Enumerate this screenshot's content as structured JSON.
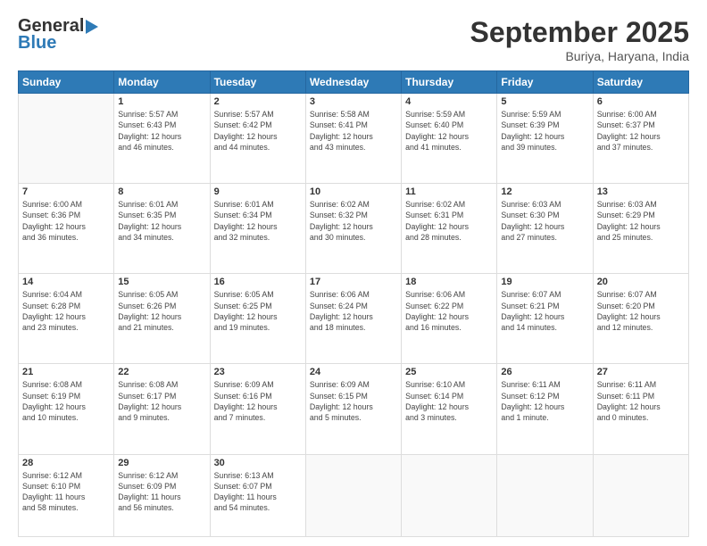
{
  "header": {
    "logo_line1": "General",
    "logo_line2": "Blue",
    "month_title": "September 2025",
    "location": "Buriya, Haryana, India"
  },
  "weekdays": [
    "Sunday",
    "Monday",
    "Tuesday",
    "Wednesday",
    "Thursday",
    "Friday",
    "Saturday"
  ],
  "weeks": [
    [
      {
        "day": "",
        "info": ""
      },
      {
        "day": "1",
        "info": "Sunrise: 5:57 AM\nSunset: 6:43 PM\nDaylight: 12 hours\nand 46 minutes."
      },
      {
        "day": "2",
        "info": "Sunrise: 5:57 AM\nSunset: 6:42 PM\nDaylight: 12 hours\nand 44 minutes."
      },
      {
        "day": "3",
        "info": "Sunrise: 5:58 AM\nSunset: 6:41 PM\nDaylight: 12 hours\nand 43 minutes."
      },
      {
        "day": "4",
        "info": "Sunrise: 5:59 AM\nSunset: 6:40 PM\nDaylight: 12 hours\nand 41 minutes."
      },
      {
        "day": "5",
        "info": "Sunrise: 5:59 AM\nSunset: 6:39 PM\nDaylight: 12 hours\nand 39 minutes."
      },
      {
        "day": "6",
        "info": "Sunrise: 6:00 AM\nSunset: 6:37 PM\nDaylight: 12 hours\nand 37 minutes."
      }
    ],
    [
      {
        "day": "7",
        "info": "Sunrise: 6:00 AM\nSunset: 6:36 PM\nDaylight: 12 hours\nand 36 minutes."
      },
      {
        "day": "8",
        "info": "Sunrise: 6:01 AM\nSunset: 6:35 PM\nDaylight: 12 hours\nand 34 minutes."
      },
      {
        "day": "9",
        "info": "Sunrise: 6:01 AM\nSunset: 6:34 PM\nDaylight: 12 hours\nand 32 minutes."
      },
      {
        "day": "10",
        "info": "Sunrise: 6:02 AM\nSunset: 6:32 PM\nDaylight: 12 hours\nand 30 minutes."
      },
      {
        "day": "11",
        "info": "Sunrise: 6:02 AM\nSunset: 6:31 PM\nDaylight: 12 hours\nand 28 minutes."
      },
      {
        "day": "12",
        "info": "Sunrise: 6:03 AM\nSunset: 6:30 PM\nDaylight: 12 hours\nand 27 minutes."
      },
      {
        "day": "13",
        "info": "Sunrise: 6:03 AM\nSunset: 6:29 PM\nDaylight: 12 hours\nand 25 minutes."
      }
    ],
    [
      {
        "day": "14",
        "info": "Sunrise: 6:04 AM\nSunset: 6:28 PM\nDaylight: 12 hours\nand 23 minutes."
      },
      {
        "day": "15",
        "info": "Sunrise: 6:05 AM\nSunset: 6:26 PM\nDaylight: 12 hours\nand 21 minutes."
      },
      {
        "day": "16",
        "info": "Sunrise: 6:05 AM\nSunset: 6:25 PM\nDaylight: 12 hours\nand 19 minutes."
      },
      {
        "day": "17",
        "info": "Sunrise: 6:06 AM\nSunset: 6:24 PM\nDaylight: 12 hours\nand 18 minutes."
      },
      {
        "day": "18",
        "info": "Sunrise: 6:06 AM\nSunset: 6:22 PM\nDaylight: 12 hours\nand 16 minutes."
      },
      {
        "day": "19",
        "info": "Sunrise: 6:07 AM\nSunset: 6:21 PM\nDaylight: 12 hours\nand 14 minutes."
      },
      {
        "day": "20",
        "info": "Sunrise: 6:07 AM\nSunset: 6:20 PM\nDaylight: 12 hours\nand 12 minutes."
      }
    ],
    [
      {
        "day": "21",
        "info": "Sunrise: 6:08 AM\nSunset: 6:19 PM\nDaylight: 12 hours\nand 10 minutes."
      },
      {
        "day": "22",
        "info": "Sunrise: 6:08 AM\nSunset: 6:17 PM\nDaylight: 12 hours\nand 9 minutes."
      },
      {
        "day": "23",
        "info": "Sunrise: 6:09 AM\nSunset: 6:16 PM\nDaylight: 12 hours\nand 7 minutes."
      },
      {
        "day": "24",
        "info": "Sunrise: 6:09 AM\nSunset: 6:15 PM\nDaylight: 12 hours\nand 5 minutes."
      },
      {
        "day": "25",
        "info": "Sunrise: 6:10 AM\nSunset: 6:14 PM\nDaylight: 12 hours\nand 3 minutes."
      },
      {
        "day": "26",
        "info": "Sunrise: 6:11 AM\nSunset: 6:12 PM\nDaylight: 12 hours\nand 1 minute."
      },
      {
        "day": "27",
        "info": "Sunrise: 6:11 AM\nSunset: 6:11 PM\nDaylight: 12 hours\nand 0 minutes."
      }
    ],
    [
      {
        "day": "28",
        "info": "Sunrise: 6:12 AM\nSunset: 6:10 PM\nDaylight: 11 hours\nand 58 minutes."
      },
      {
        "day": "29",
        "info": "Sunrise: 6:12 AM\nSunset: 6:09 PM\nDaylight: 11 hours\nand 56 minutes."
      },
      {
        "day": "30",
        "info": "Sunrise: 6:13 AM\nSunset: 6:07 PM\nDaylight: 11 hours\nand 54 minutes."
      },
      {
        "day": "",
        "info": ""
      },
      {
        "day": "",
        "info": ""
      },
      {
        "day": "",
        "info": ""
      },
      {
        "day": "",
        "info": ""
      }
    ]
  ]
}
